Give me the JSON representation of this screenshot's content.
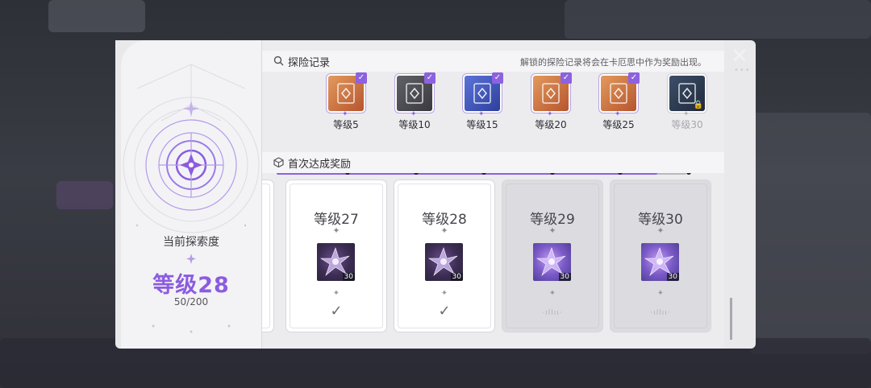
{
  "current": {
    "label": "当前探索度",
    "level": "等级28",
    "progress": "50/200"
  },
  "records": {
    "title": "探险记录",
    "note": "解锁的探险记录将会在卡厄思中作为奖励出现。",
    "progress_fraction": 0.93,
    "items": [
      {
        "label": "等级5",
        "style": "orange",
        "status": "checked"
      },
      {
        "label": "等级10",
        "style": "grey",
        "status": "checked"
      },
      {
        "label": "等级15",
        "style": "blue",
        "status": "checked"
      },
      {
        "label": "等级20",
        "style": "orange",
        "status": "checked"
      },
      {
        "label": "等级25",
        "style": "orange",
        "status": "checked"
      },
      {
        "label": "等级30",
        "style": "dark",
        "status": "locked"
      }
    ]
  },
  "rewards": {
    "title": "首次达成奖励",
    "cards": [
      {
        "level": "等级27",
        "qty": "30",
        "claimed": true
      },
      {
        "level": "等级28",
        "qty": "30",
        "claimed": true
      },
      {
        "level": "等级29",
        "qty": "30",
        "claimed": false
      },
      {
        "level": "等级30",
        "qty": "30",
        "claimed": false
      }
    ]
  },
  "icons": {
    "close": "close-icon",
    "search": "search-icon",
    "reward": "cube-icon",
    "compass": "compass-icon",
    "check": "check-icon",
    "lock": "lock-icon"
  },
  "colors": {
    "accent": "#8b5ce0",
    "panel": "#ececef"
  }
}
